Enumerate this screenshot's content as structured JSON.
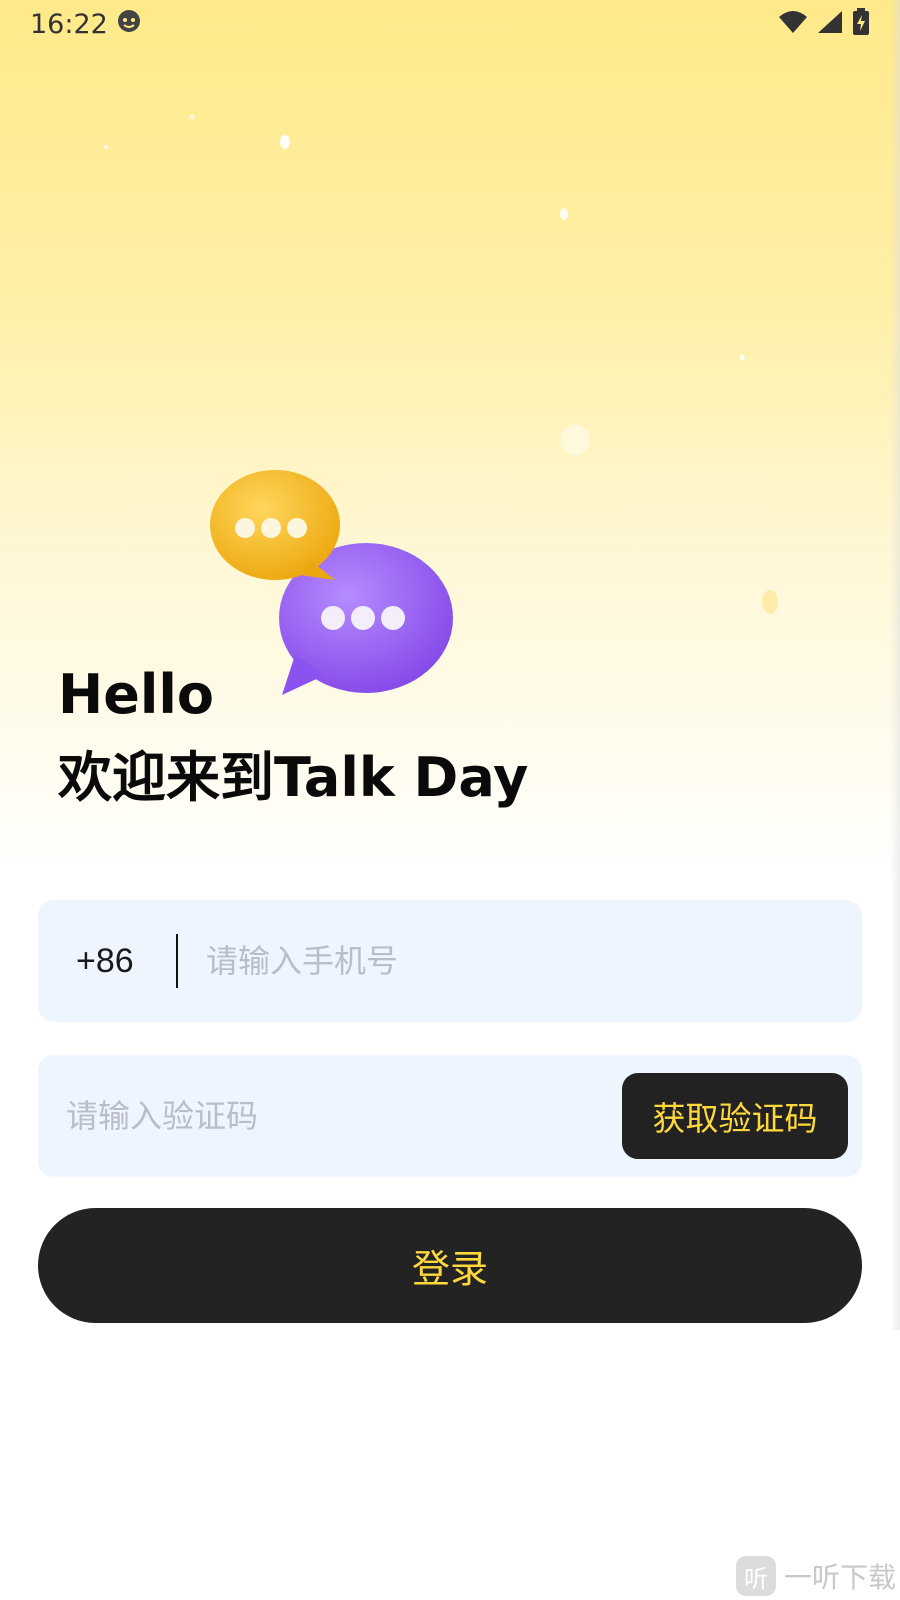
{
  "status_bar": {
    "time": "16:22",
    "icons": [
      "face-icon",
      "wifi-icon",
      "signal-icon",
      "battery-charging-icon"
    ]
  },
  "header": {
    "hello": "Hello",
    "welcome": "欢迎来到Talk Day"
  },
  "illustration": {
    "bubble_colors": {
      "yellow": "#f5b81c",
      "purple": "#9a62f0"
    }
  },
  "phone_field": {
    "country_code": "+86",
    "placeholder": "请输入手机号",
    "value": ""
  },
  "code_field": {
    "placeholder": "请输入验证码",
    "value": "",
    "get_code_label": "获取验证码"
  },
  "login": {
    "label": "登录"
  },
  "watermark": {
    "logo": "听",
    "text": "一听下载"
  },
  "colors": {
    "accent": "#ffd93b",
    "button_bg": "#232323",
    "field_bg": "#eef5fe"
  }
}
